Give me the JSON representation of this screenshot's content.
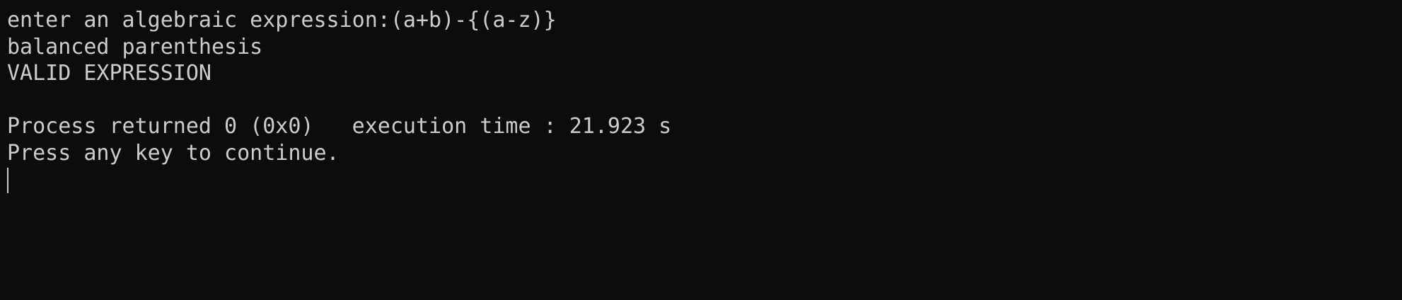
{
  "console": {
    "background_color": "#0c0c0c",
    "text_color": "#cccccc",
    "lines": [
      "enter an algebraic expression:(a+b)-{(a-z)}",
      "balanced parenthesis",
      "VALID EXPRESSION",
      "",
      "Process returned 0 (0x0)   execution time : 21.923 s",
      "Press any key to continue."
    ]
  }
}
